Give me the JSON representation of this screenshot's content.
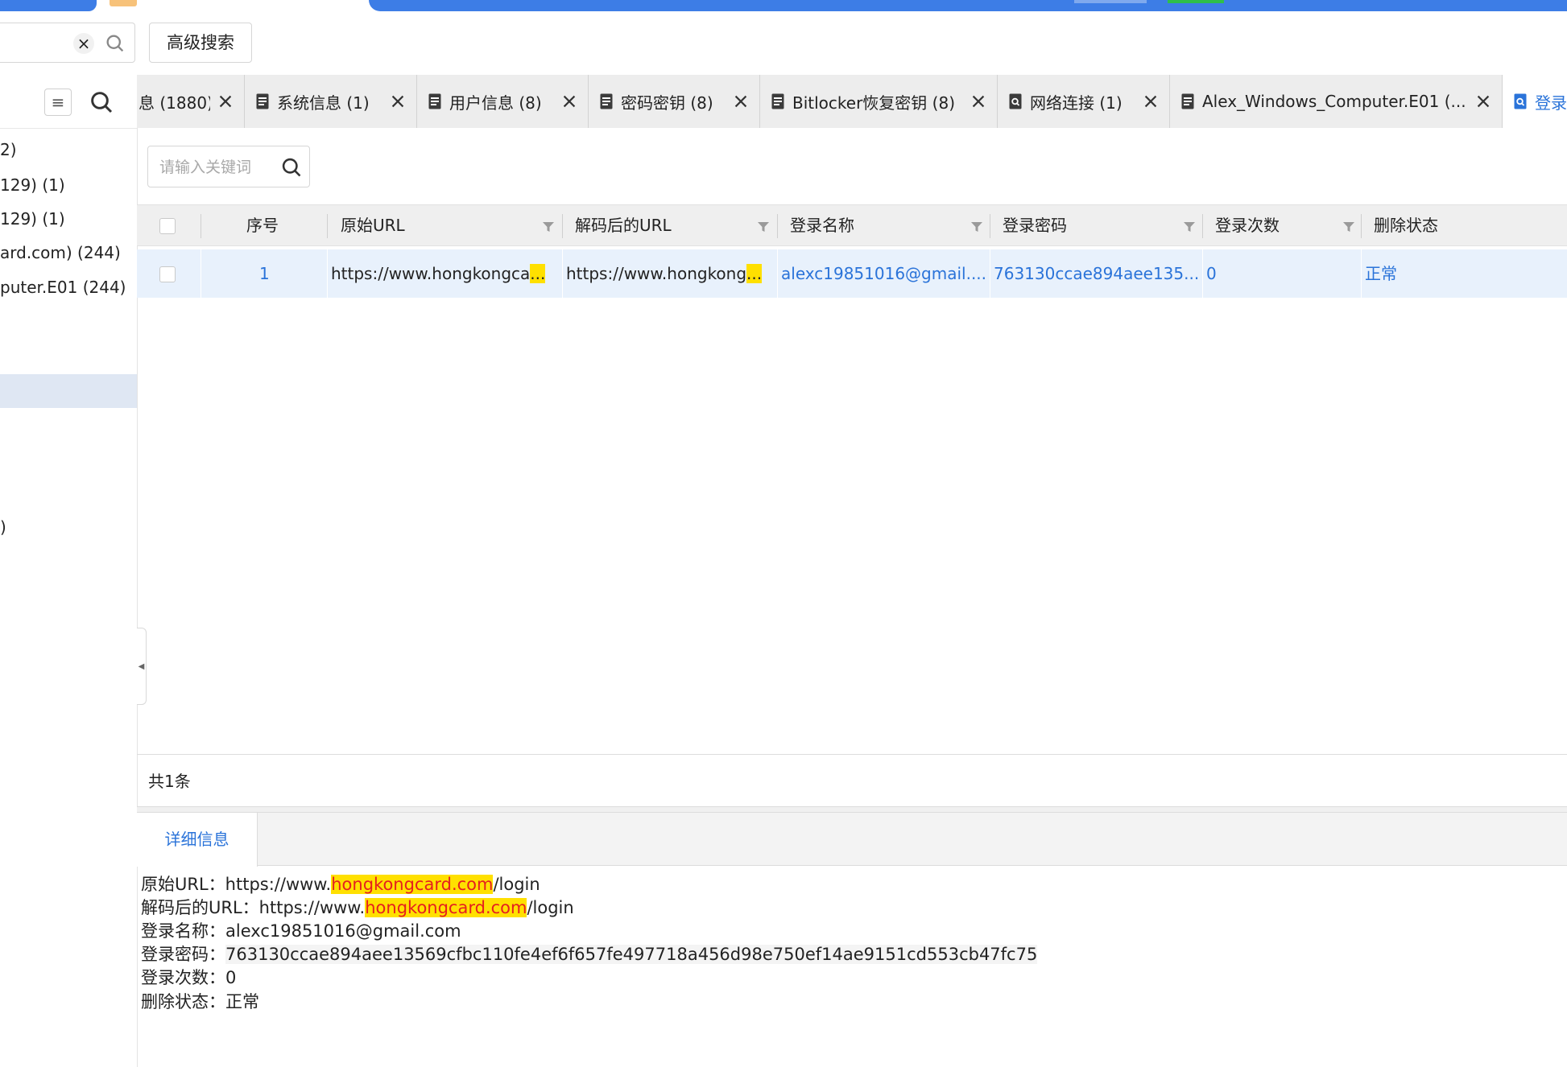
{
  "toolbar": {
    "advanced_search_label": "高级搜索"
  },
  "left_panel": {
    "tree_items": [
      "2)",
      "129) (1)",
      "129) (1)",
      "ard.com) (244)",
      "puter.E01 (244)",
      ")"
    ]
  },
  "tabs": [
    {
      "label": "息 (1880)"
    },
    {
      "label": "系统信息 (1)"
    },
    {
      "label": "用户信息 (8)"
    },
    {
      "label": "密码密钥 (8)"
    },
    {
      "label": "Bitlocker恢复密钥 (8)"
    },
    {
      "label": "网络连接 (1)"
    },
    {
      "label": "Alex_Windows_Computer.E01 (..."
    },
    {
      "label": "登录"
    }
  ],
  "keyword_search": {
    "placeholder": "请输入关键词"
  },
  "table": {
    "columns": [
      "序号",
      "原始URL",
      "解码后的URL",
      "登录名称",
      "登录密码",
      "登录次数",
      "删除状态"
    ],
    "rows": [
      {
        "index": "1",
        "original_url": "https://www.hongkongca",
        "decoded_url": "https://www.hongkong",
        "login_name": "alexc19851016@gmail....",
        "login_password": "763130ccae894aee135...",
        "login_count": "0",
        "delete_status": "正常"
      }
    ],
    "ellipsis": "...",
    "total_label": "共1条"
  },
  "detail": {
    "tab_label": "详细信息",
    "original_url_label": "原始URL：",
    "original_url_prefix": "https://www.",
    "original_url_highlight": "hongkongcard.com",
    "original_url_suffix": "/login",
    "decoded_url_label": "解码后的URL：",
    "decoded_url_prefix": "https://www.",
    "decoded_url_highlight": "hongkongcard.com",
    "decoded_url_suffix": "/login",
    "login_name_label": "登录名称：",
    "login_name_value": "alexc19851016@gmail.com",
    "login_password_label": "登录密码：",
    "login_password_value": "763130ccae894aee13569cfbc110fe4ef6f657fe497718a456d98e750ef14ae9151cd553cb47fc75",
    "login_count_label": "登录次数：",
    "login_count_value": "0",
    "delete_status_label": "删除状态：",
    "delete_status_value": "正常"
  },
  "colors": {
    "accent": "#2a73d9",
    "highlight_bg": "#ffe000",
    "highlight_text": "#e51f1f",
    "row_selected": "#e8f1fc"
  }
}
